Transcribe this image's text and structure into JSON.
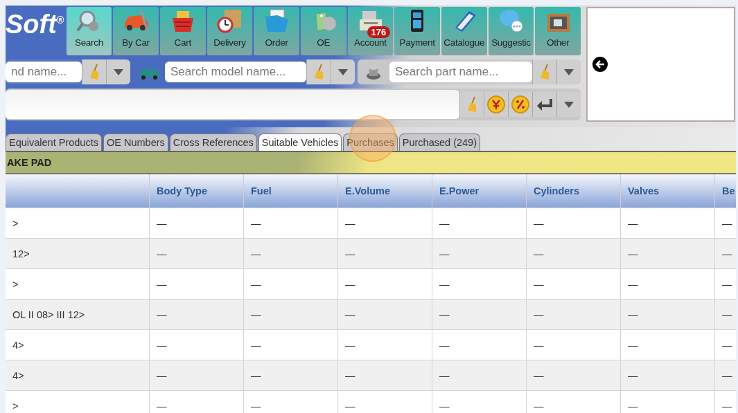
{
  "logo": "Soft$^{®}$",
  "toolbar": [
    {
      "label": "Search",
      "selected": true
    },
    {
      "label": "By Car",
      "selected": false
    },
    {
      "label": "Cart",
      "selected": false
    },
    {
      "label": "Delivery",
      "selected": false
    },
    {
      "label": "Order",
      "selected": false
    },
    {
      "label": "OE",
      "selected": false
    },
    {
      "label": "Account",
      "selected": false,
      "badge": "176"
    },
    {
      "label": "Payment",
      "selected": false
    },
    {
      "label": "Catalogue",
      "selected": false
    },
    {
      "label": "Suggestic",
      "selected": false
    },
    {
      "label": "Other",
      "selected": false
    }
  ],
  "search_fields": [
    {
      "placeholder": "nd name..."
    },
    {
      "placeholder": "Search model name..."
    },
    {
      "placeholder": "Search part name..."
    }
  ],
  "tabs": [
    {
      "label": "Equivalent Products",
      "selected": false
    },
    {
      "label": "OE Numbers",
      "selected": false
    },
    {
      "label": "Cross References",
      "selected": false
    },
    {
      "label": "Suitable Vehicles",
      "selected": true
    },
    {
      "label": "Purchases",
      "selected": false
    },
    {
      "label": "Purchased (249)",
      "selected": false
    }
  ],
  "section_title": "AKE PAD",
  "table": {
    "columns": [
      "",
      "Body Type",
      "Fuel",
      "E.Volume",
      "E.Power",
      "Cylinders",
      "Valves",
      "Be"
    ],
    "rows": [
      [
        ">",
        "—",
        "—",
        "—",
        "—",
        "—",
        "—",
        "—"
      ],
      [
        "12>",
        "—",
        "—",
        "—",
        "—",
        "—",
        "—",
        "—"
      ],
      [
        ">",
        "—",
        "—",
        "—",
        "—",
        "—",
        "—",
        "—"
      ],
      [
        "OL II 08> III 12>",
        "—",
        "—",
        "—",
        "—",
        "—",
        "—",
        "—"
      ],
      [
        "4>",
        "—",
        "—",
        "—",
        "—",
        "—",
        "—",
        "—"
      ],
      [
        "4>",
        "—",
        "—",
        "—",
        "—",
        "—",
        "—",
        "—"
      ],
      [
        ">",
        "—",
        "—",
        "—",
        "—",
        "—",
        "—",
        "—"
      ]
    ]
  }
}
